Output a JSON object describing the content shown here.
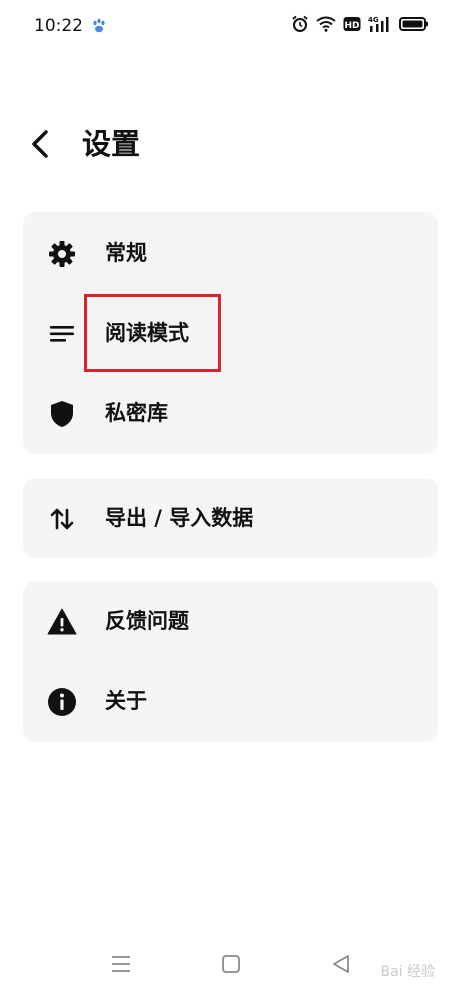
{
  "status_bar": {
    "time": "10:22"
  },
  "header": {
    "title": "设置"
  },
  "cards": {
    "general": {
      "label": "常规"
    },
    "reading_mode": {
      "label": "阅读模式"
    },
    "private_vault": {
      "label": "私密库"
    },
    "import_export": {
      "label": "导出 / 导入数据"
    },
    "feedback": {
      "label": "反馈问题"
    },
    "about": {
      "label": "关于"
    }
  },
  "watermark": {
    "text": "Bai 经验"
  },
  "colors": {
    "background": "#ffffff",
    "card": "#f5f5f5",
    "text": "#111111",
    "highlight": "#d9242f"
  },
  "icons": {
    "general": "gear-icon",
    "reading_mode": "lines-icon",
    "private_vault": "shield-icon",
    "import_export": "swap-arrows-icon",
    "feedback": "warning-icon",
    "about": "info-icon"
  }
}
